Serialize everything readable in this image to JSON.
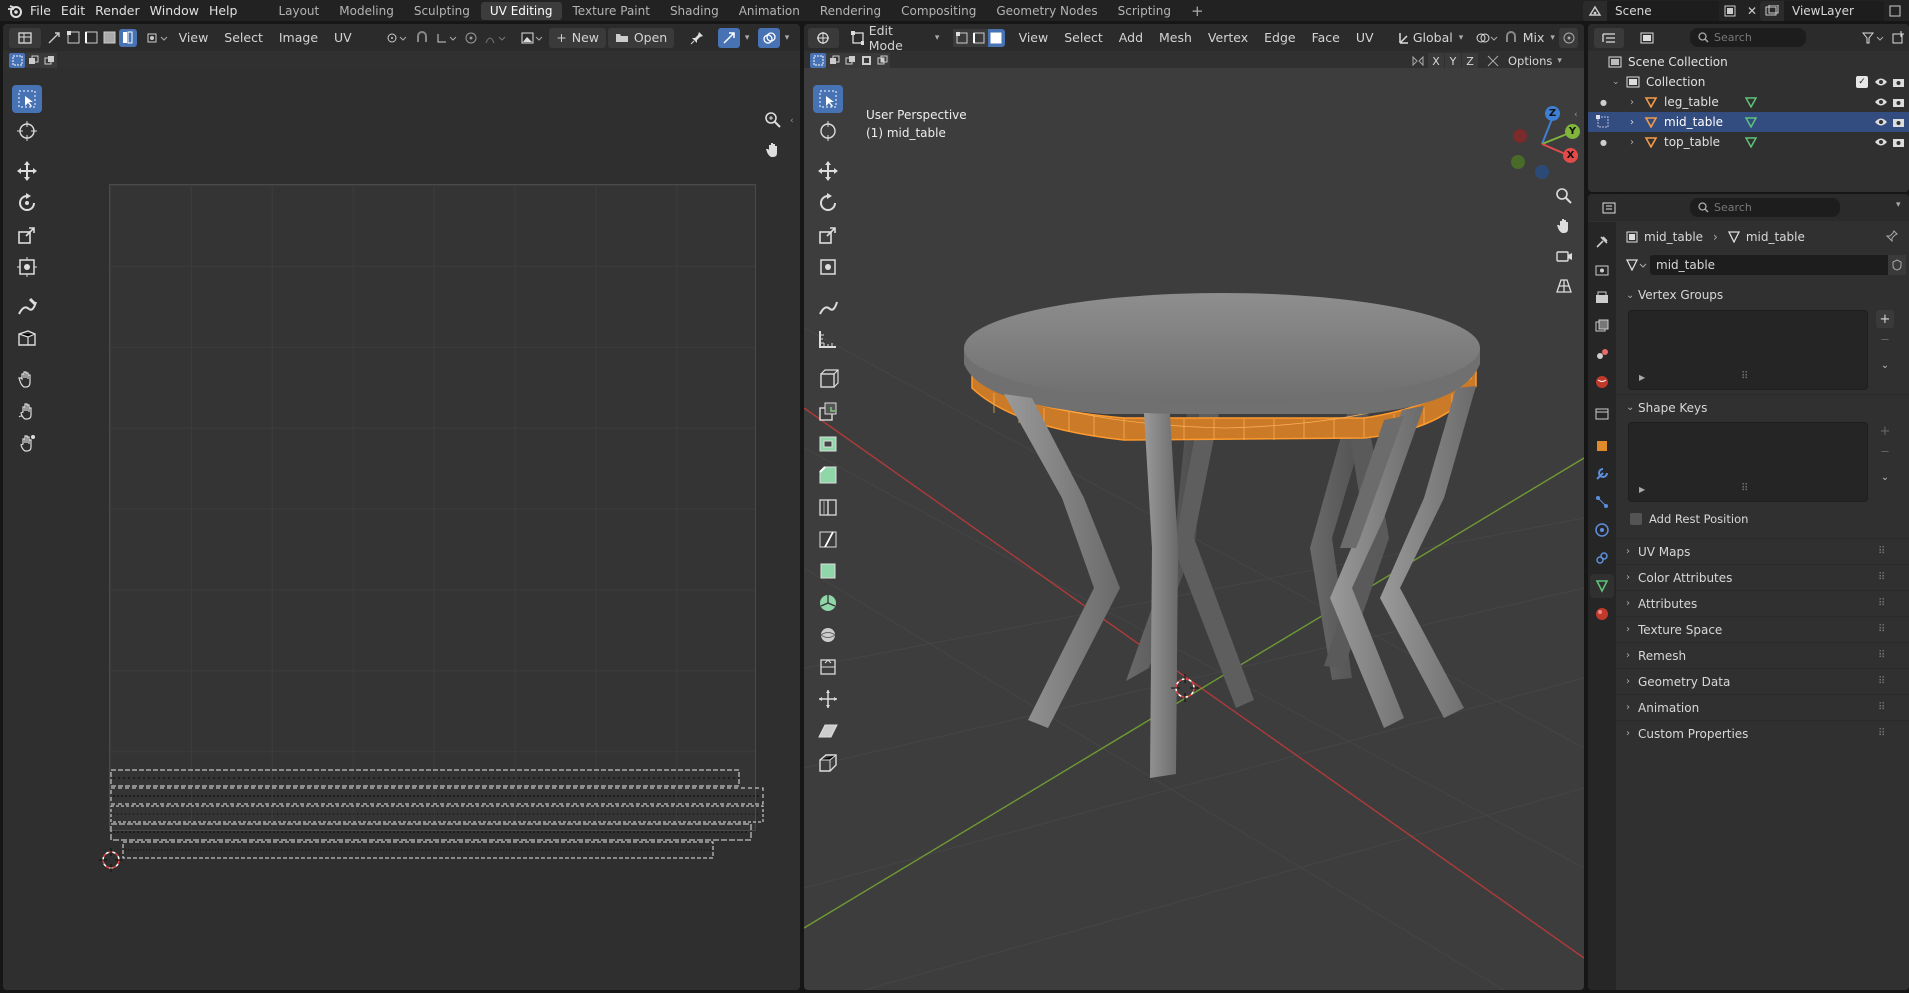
{
  "topbar": {
    "menus": [
      "File",
      "Edit",
      "Render",
      "Window",
      "Help"
    ],
    "workspaces": [
      "Layout",
      "Modeling",
      "Sculpting",
      "UV Editing",
      "Texture Paint",
      "Shading",
      "Animation",
      "Rendering",
      "Compositing",
      "Geometry Nodes",
      "Scripting"
    ],
    "active_workspace": "UV Editing",
    "scene": "Scene",
    "view_layer": "ViewLayer"
  },
  "uv_editor": {
    "menus": [
      "View",
      "Select",
      "Image",
      "UV"
    ],
    "new_label": "New",
    "open_label": "Open"
  },
  "viewport": {
    "mode": "Edit Mode",
    "menus": [
      "View",
      "Select",
      "Add",
      "Mesh",
      "Vertex",
      "Edge",
      "Face",
      "UV"
    ],
    "orientation": "Global",
    "snap_mode": "Mix",
    "axes": [
      "X",
      "Y",
      "Z"
    ],
    "options_label": "Options",
    "perspective_label": "User Perspective",
    "object_label": "(1) mid_table",
    "gizmo": {
      "x": "X",
      "y": "Y",
      "z": "Z"
    }
  },
  "outliner": {
    "search_placeholder": "Search",
    "scene_collection": "Scene Collection",
    "collection": "Collection",
    "objects": [
      {
        "name": "leg_table",
        "selected": false
      },
      {
        "name": "mid_table",
        "selected": true
      },
      {
        "name": "top_table",
        "selected": false
      }
    ]
  },
  "properties": {
    "search_placeholder": "Search",
    "breadcrumb_object": "mid_table",
    "breadcrumb_mesh": "mid_table",
    "mesh_name": "mid_table",
    "vertex_groups": "Vertex Groups",
    "shape_keys": "Shape Keys",
    "add_rest_position": "Add Rest Position",
    "collapsed_sections": [
      "UV Maps",
      "Color Attributes",
      "Attributes",
      "Texture Space",
      "Remesh",
      "Geometry Data",
      "Animation",
      "Custom Properties"
    ]
  },
  "colors": {
    "accent": "#4772b3",
    "selection_orange": "#ff8c1a",
    "x_axis": "#e34b4b",
    "y_axis": "#7fb53b",
    "z_axis": "#3e7fd6"
  }
}
